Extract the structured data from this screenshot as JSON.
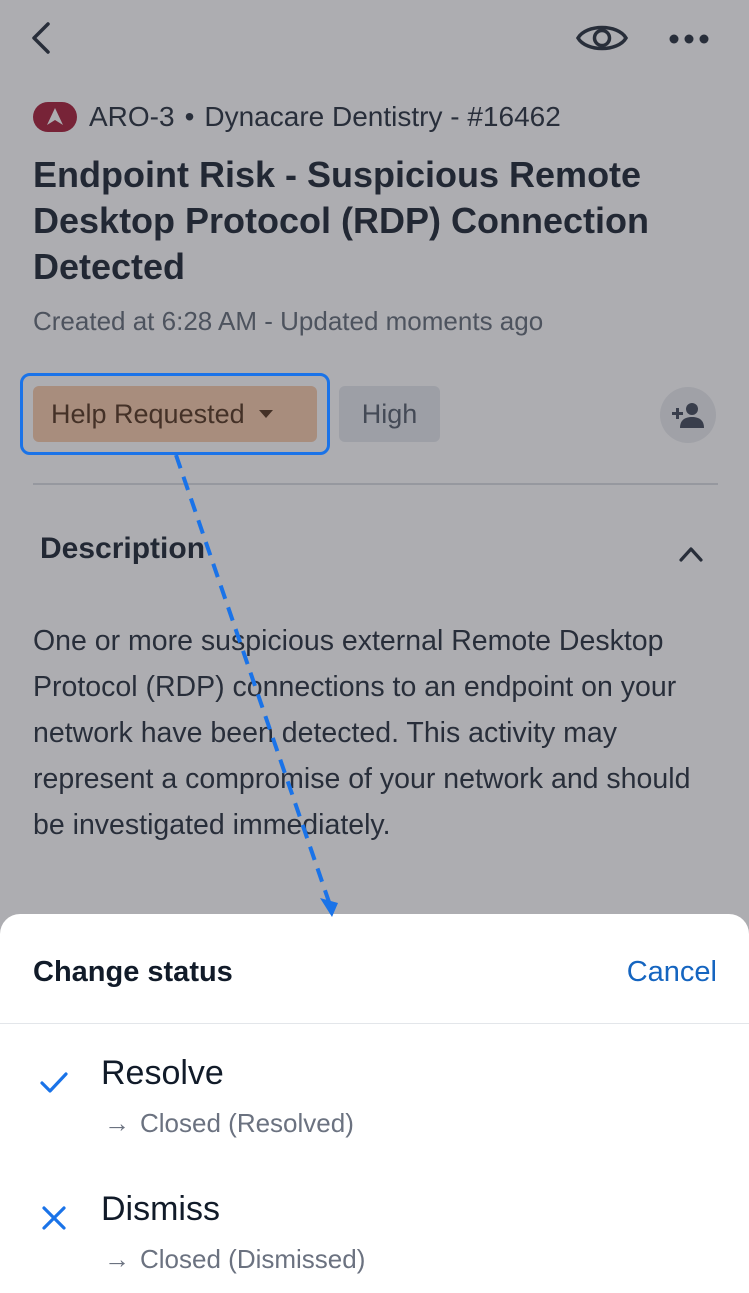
{
  "header": {
    "back_icon": "chevron-left-icon",
    "watch_icon": "eye-icon",
    "more_icon": "ellipsis-icon"
  },
  "meta": {
    "org_code": "ARO-3",
    "separator": "•",
    "client": "Dynacare Dentistry - #16462"
  },
  "ticket": {
    "title": "Endpoint Risk - Suspicious Remote Desktop Protocol (RDP) Connection Detected",
    "subtitle": "Created at 6:28 AM - Updated moments ago",
    "status": "Help Requested",
    "priority": "High",
    "assign_icon": "add-person-icon"
  },
  "description": {
    "heading": "Description",
    "body": "One or more suspicious external Remote Desktop Protocol (RDP) connections to an endpoint on your network have been detected. This activity may represent a compromise of your network and should be investigated immediately."
  },
  "sheet": {
    "title": "Change status",
    "cancel": "Cancel",
    "options": [
      {
        "label": "Resolve",
        "sub": "Closed (Resolved)",
        "icon": "check-icon"
      },
      {
        "label": "Dismiss",
        "sub": "Closed (Dismissed)",
        "icon": "x-icon"
      }
    ]
  },
  "colors": {
    "accent": "#1a73e8",
    "status_pill": "#f7c8a5",
    "org_badge": "#a3122e"
  }
}
